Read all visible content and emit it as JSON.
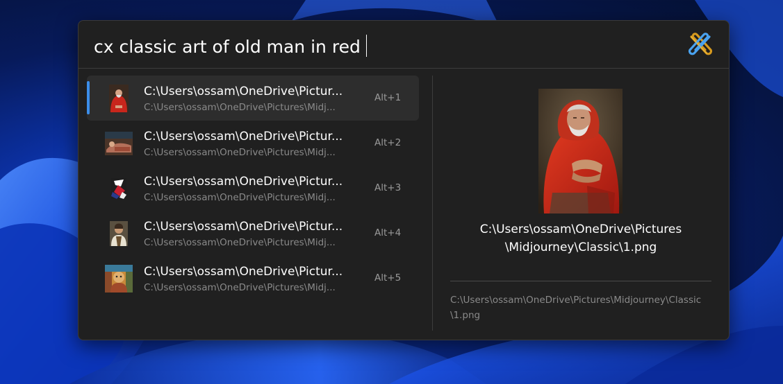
{
  "search": {
    "query": "cx classic art of old man in red"
  },
  "app": {
    "logo_icon": "paperclip-cross-logo-icon"
  },
  "results": [
    {
      "title": "C:\\Users\\ossam\\OneDrive\\Pictur...",
      "subtitle": "C:\\Users\\ossam\\OneDrive\\Pictures\\Midj...",
      "shortcut": "Alt+1",
      "selected": true,
      "thumbnail": "old-man-red-robe-thumbnail"
    },
    {
      "title": "C:\\Users\\ossam\\OneDrive\\Pictur...",
      "subtitle": "C:\\Users\\ossam\\OneDrive\\Pictures\\Midj...",
      "shortcut": "Alt+2",
      "selected": false,
      "thumbnail": "reclining-figure-thumbnail"
    },
    {
      "title": "C:\\Users\\ossam\\OneDrive\\Pictur...",
      "subtitle": "C:\\Users\\ossam\\OneDrive\\Pictures\\Midj...",
      "shortcut": "Alt+3",
      "selected": false,
      "thumbnail": "abstract-figure-thumbnail"
    },
    {
      "title": "C:\\Users\\ossam\\OneDrive\\Pictur...",
      "subtitle": "C:\\Users\\ossam\\OneDrive\\Pictures\\Midj...",
      "shortcut": "Alt+4",
      "selected": false,
      "thumbnail": "portrait-thumbnail"
    },
    {
      "title": "C:\\Users\\ossam\\OneDrive\\Pictur...",
      "subtitle": "C:\\Users\\ossam\\OneDrive\\Pictures\\Midj...",
      "shortcut": "Alt+5",
      "selected": false,
      "thumbnail": "colorful-portrait-thumbnail"
    }
  ],
  "preview": {
    "image": "old-man-red-robe-preview",
    "title_line1": "C:\\Users\\ossam\\OneDrive\\Pictures",
    "title_line2": "\\Midjourney\\Classic\\1.png",
    "path_line1": "C:\\Users\\ossam\\OneDrive\\Pictures\\Midjourney\\Classic",
    "path_line2": "\\1.png"
  },
  "colors": {
    "accent": "#3b8eea",
    "panel_bg": "#202020",
    "selected_row_bg": "#2d2d2d"
  }
}
